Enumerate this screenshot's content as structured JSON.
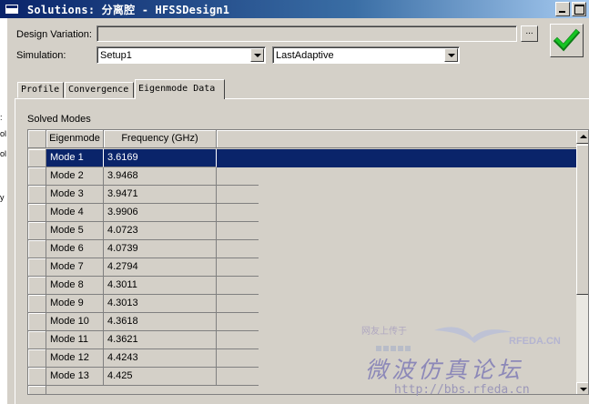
{
  "window": {
    "title": "Solutions: 分离腔 - HFSSDesign1"
  },
  "form": {
    "design_variation_label": "Design Variation:",
    "design_variation_value": "",
    "browse_label": "...",
    "simulation_label": "Simulation:",
    "setup_value": "Setup1",
    "pass_value": "LastAdaptive"
  },
  "tabs": [
    {
      "label": "Profile",
      "active": false
    },
    {
      "label": "Convergence",
      "active": false
    },
    {
      "label": "Eigenmode Data",
      "active": true
    }
  ],
  "panel": {
    "section_label": "Solved Modes"
  },
  "table": {
    "columns": [
      "Eigenmode",
      "Frequency (GHz)"
    ],
    "rows": [
      {
        "mode": "Mode 1",
        "freq": "3.6169"
      },
      {
        "mode": "Mode 2",
        "freq": "3.9468"
      },
      {
        "mode": "Mode 3",
        "freq": "3.9471"
      },
      {
        "mode": "Mode 4",
        "freq": "3.9906"
      },
      {
        "mode": "Mode 5",
        "freq": "4.0723"
      },
      {
        "mode": "Mode 6",
        "freq": "4.0739"
      },
      {
        "mode": "Mode 7",
        "freq": "4.2794"
      },
      {
        "mode": "Mode 8",
        "freq": "4.3011"
      },
      {
        "mode": "Mode 9",
        "freq": "4.3013"
      },
      {
        "mode": "Mode 10",
        "freq": "4.3618"
      },
      {
        "mode": "Mode 11",
        "freq": "4.3621"
      },
      {
        "mode": "Mode 12",
        "freq": "4.4243"
      },
      {
        "mode": "Mode 13",
        "freq": "4.425"
      }
    ],
    "selected_row": 0
  },
  "watermark": {
    "top_text": "网友上传于",
    "brand": "RFEDA.CN",
    "big_text": "微波仿真论坛",
    "url": "http://bbs.rfeda.cn"
  },
  "colors": {
    "selection": "#0a246a",
    "ok_check": "#12a81e"
  }
}
